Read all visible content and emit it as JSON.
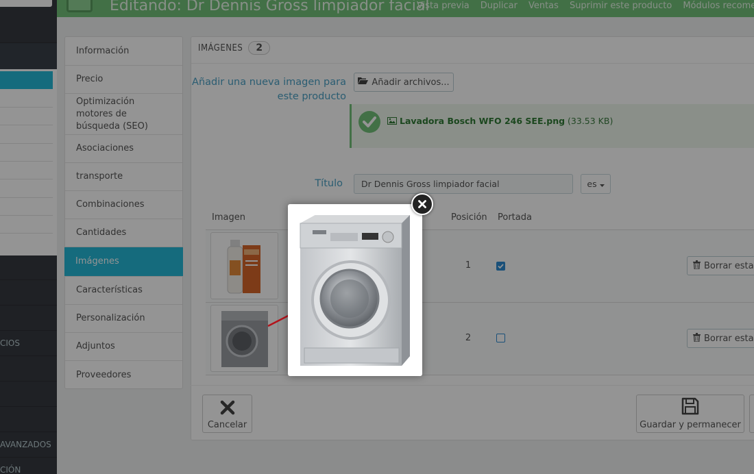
{
  "header": {
    "title": "Editando: Dr Dennis Gross limpiador facial",
    "actions": [
      "Vista previa",
      "Duplicar",
      "Ventas",
      "Suprimir este producto",
      "Módulos recomenda"
    ]
  },
  "sidebar": {
    "items": [
      {
        "label": "CIOS"
      },
      {
        "label": "AVANZADOS"
      },
      {
        "label": "CIÓN"
      }
    ]
  },
  "tabs": [
    {
      "label": "Información"
    },
    {
      "label": "Precio"
    },
    {
      "label": "Optimización motores de búsqueda (SEO)"
    },
    {
      "label": "Asociaciones"
    },
    {
      "label": "transporte"
    },
    {
      "label": "Combinaciones"
    },
    {
      "label": "Cantidades"
    },
    {
      "label": "Imágenes"
    },
    {
      "label": "Características"
    },
    {
      "label": "Personalización"
    },
    {
      "label": "Adjuntos"
    },
    {
      "label": "Proveedores"
    }
  ],
  "panel": {
    "heading": "IMÁGENES",
    "count": "2",
    "add_label": "Añadir una nueva imagen para este producto",
    "add_files_button": "Añadir archivos...",
    "uploaded_file": "Lavadora Bosch WFO 246 SEE.png",
    "uploaded_size": "(33.53 KB)",
    "title_label": "Título",
    "title_value": "Dr Dennis Gross limpiador facial",
    "lang": "es"
  },
  "table": {
    "headers": {
      "image": "Imagen",
      "position": "Posición",
      "cover": "Portada"
    },
    "rows": [
      {
        "position": "1",
        "cover": true,
        "delete_label": "Borrar esta"
      },
      {
        "position": "2",
        "cover": false,
        "delete_label": "Borrar esta"
      }
    ]
  },
  "footer": {
    "cancel": "Cancelar",
    "save_stay": "Guardar y permanecer"
  },
  "colors": {
    "accent": "#25b9d7",
    "header": "#72c279",
    "sidebar": "#363a41",
    "checkbox": "#2d8bd0"
  }
}
